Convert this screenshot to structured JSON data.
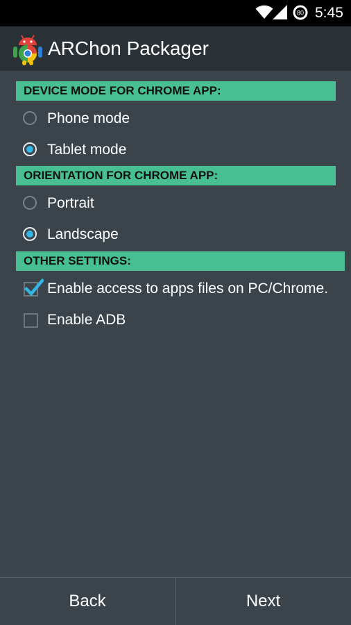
{
  "status_bar": {
    "time": "5:45",
    "battery_level": "80",
    "icons": [
      "wifi-icon",
      "signal-icon",
      "battery-icon"
    ]
  },
  "action_bar": {
    "title": "ARChon Packager",
    "icon": "archon-app-icon"
  },
  "sections": {
    "device_mode": {
      "header": "DEVICE MODE FOR CHROME APP:",
      "options": [
        {
          "label": "Phone mode",
          "checked": false
        },
        {
          "label": "Tablet mode",
          "checked": true
        }
      ]
    },
    "orientation": {
      "header": "ORIENTATION FOR CHROME APP:",
      "options": [
        {
          "label": "Portrait",
          "checked": false
        },
        {
          "label": "Landscape",
          "checked": true
        }
      ]
    },
    "other_settings": {
      "header": "OTHER SETTINGS:",
      "options": [
        {
          "label": "Enable access to apps files on PC/Chrome.",
          "checked": true
        },
        {
          "label": "Enable ADB",
          "checked": false
        }
      ]
    }
  },
  "footer": {
    "back_label": "Back",
    "next_label": "Next"
  },
  "colors": {
    "section_header_bg": "#48bf93",
    "radio_accent": "#33b5e5",
    "background": "#3b444b",
    "action_bar_bg": "#2a3137"
  }
}
